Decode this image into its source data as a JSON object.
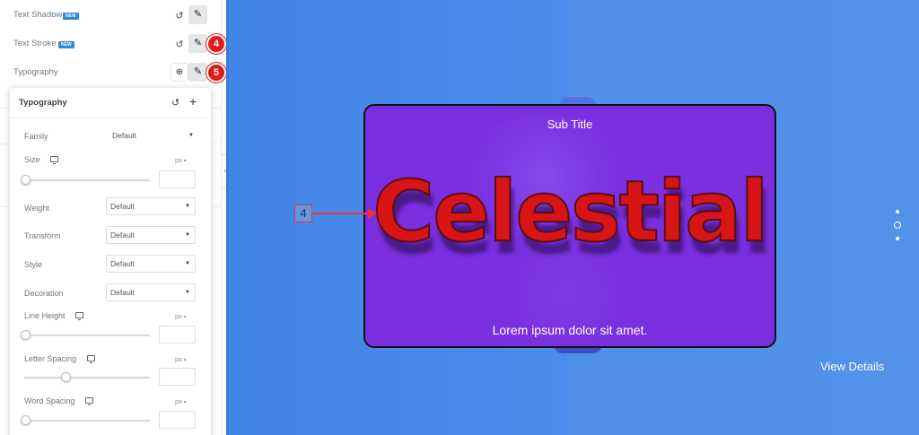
{
  "panel": {
    "text_shadow": {
      "label": "Text Shadow",
      "badge": "NEW"
    },
    "text_stroke": {
      "label": "Text Stroke",
      "badge": "NEW",
      "step_marker": "4"
    },
    "typography": {
      "label": "Typography",
      "step_marker": "5"
    }
  },
  "typography_popover": {
    "title": "Typography",
    "family": {
      "label": "Family",
      "value": "Default"
    },
    "size": {
      "label": "Size",
      "unit": "px",
      "slider_position": 0
    },
    "weight": {
      "label": "Weight",
      "value": "Default"
    },
    "transform": {
      "label": "Transform",
      "value": "Default"
    },
    "style": {
      "label": "Style",
      "value": "Default"
    },
    "decoration": {
      "label": "Decoration",
      "value": "Default"
    },
    "line_height": {
      "label": "Line Height",
      "unit": "px",
      "slider_position": 0
    },
    "letter_spacing": {
      "label": "Letter Spacing",
      "unit": "px",
      "slider_position": 0.32
    },
    "word_spacing": {
      "label": "Word Spacing",
      "unit": "px",
      "slider_position": 0
    }
  },
  "canvas": {
    "card": {
      "sub_title": "Sub Title",
      "headline": "Celestial",
      "description": "Lorem ipsum dolor sit amet."
    },
    "view_details": "View Details",
    "annotation_label": "4"
  },
  "colors": {
    "canvas_bg": "#4a8ce9",
    "card_bg": "#7a2fe0",
    "headline_fill": "#d71515",
    "headline_stroke": "#5a0d18",
    "marker_red": "#e11a1a",
    "badge_blue": "#2e8bd8"
  },
  "icons": {
    "reset": "undo-icon",
    "edit": "pencil-icon",
    "global": "globe-icon",
    "add": "plus-icon",
    "responsive": "monitor-icon",
    "collapse": "chevron-left-icon"
  }
}
